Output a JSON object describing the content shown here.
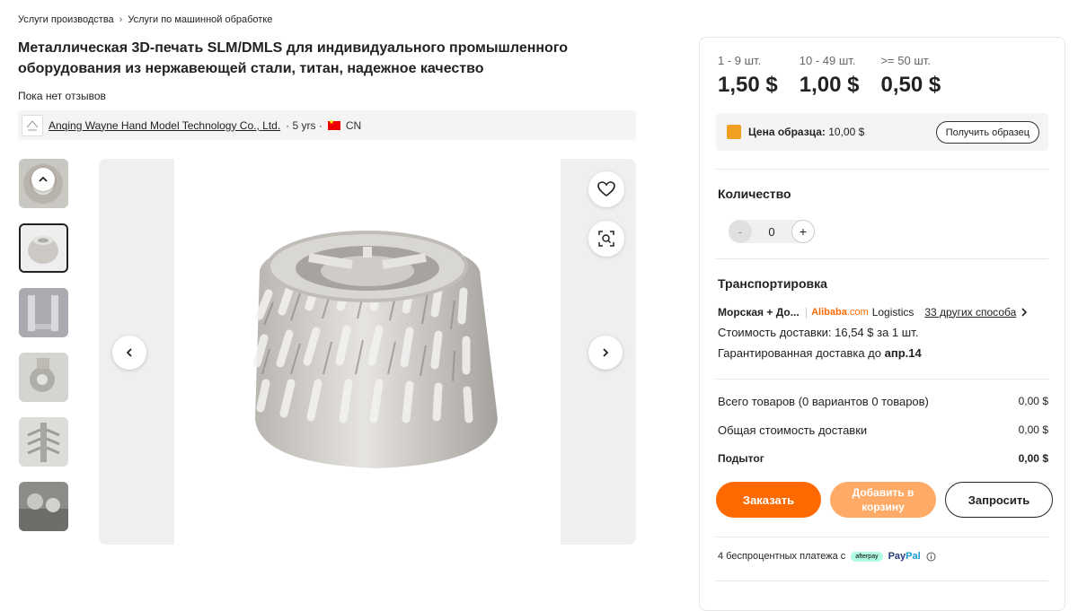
{
  "breadcrumb": {
    "items": [
      "Услуги производства",
      "Услуги по машинной обработке"
    ],
    "sep": "›"
  },
  "product": {
    "title": "Металлическая 3D-печать SLM/DMLS для индивидуального промышленного оборудования из нержавеющей стали, титан, надежное качество",
    "reviews": "Пока нет отзывов"
  },
  "supplier": {
    "name": "Anqing Wayne Hand Model Technology Co., Ltd.",
    "years": "· 5 yrs ·",
    "country": "CN"
  },
  "prices": [
    {
      "qty": "1 - 9 шт.",
      "price": "1,50 $"
    },
    {
      "qty": "10 - 49 шт.",
      "price": "1,00 $"
    },
    {
      "qty": ">= 50 шт.",
      "price": "0,50 $"
    }
  ],
  "sample": {
    "label": "Цена образца:",
    "value": "10,00 $",
    "button": "Получить образец"
  },
  "quantity": {
    "title": "Количество",
    "value": "0",
    "minus": "-",
    "plus": "+"
  },
  "shipping": {
    "title": "Транспортировка",
    "method": "Морская + До...",
    "logistics_brand": "Alibaba",
    "logistics_domain": ".com",
    "logistics_label": "Logistics",
    "others": "33 других способа",
    "cost": "Стоимость доставки: 16,54 $ за 1 шт.",
    "guarantee_prefix": "Гарантированная доставка до",
    "guarantee_date": "апр.14"
  },
  "summary": {
    "items_label": "Всего товаров (0 вариантов 0 товаров)",
    "items_value": "0,00 $",
    "shipping_label": "Общая стоимость доставки",
    "shipping_value": "0,00 $",
    "subtotal_label": "Подытог",
    "subtotal_value": "0,00 $"
  },
  "actions": {
    "order": "Заказать",
    "cart": "Добавить в корзину",
    "inquire": "Запросить"
  },
  "payment": {
    "text": "4 беспроцентных платежа с",
    "afterpay": "afterpay",
    "paypal_a": "Pay",
    "paypal_b": "Pal"
  },
  "icons": {
    "up": "chevron-up-icon",
    "left": "chevron-left-icon",
    "right": "chevron-right-icon",
    "heart": "heart-icon",
    "scan": "image-search-icon"
  }
}
